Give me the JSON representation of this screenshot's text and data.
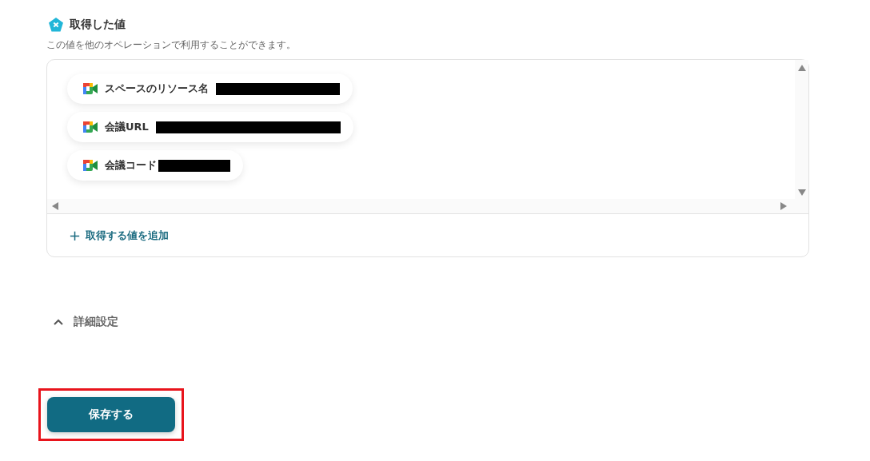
{
  "section": {
    "title": "取得した値",
    "description": "この値を他のオペレーションで利用することができます。"
  },
  "values": [
    {
      "label": "スペースのリソース名",
      "redacted": true
    },
    {
      "label": "会議URL",
      "redacted": true
    },
    {
      "label": "会議コード",
      "redacted": true
    }
  ],
  "add_link": {
    "icon": "+",
    "label": "取得する値を追加"
  },
  "details": {
    "label": "詳細設定",
    "expanded": true
  },
  "save_button": {
    "label": "保存する",
    "highlighted": true
  }
}
